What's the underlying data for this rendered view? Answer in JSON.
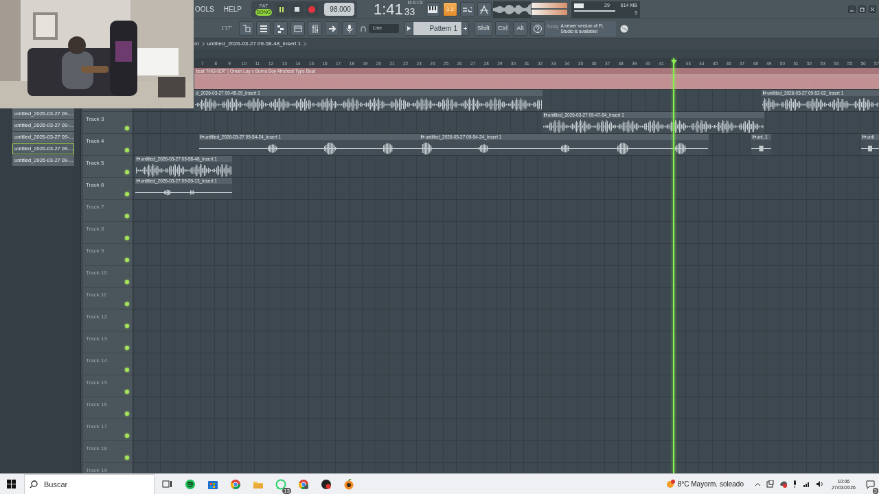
{
  "menu": [
    {
      "label": "OOLS"
    },
    {
      "label": "HELP"
    }
  ],
  "transport": {
    "modes": [
      {
        "label": "PAT",
        "selected": false
      },
      {
        "label": "SONG",
        "selected": true
      }
    ],
    "playing": true,
    "tempo": "98.000"
  },
  "time_display": {
    "value": "1:41",
    "fraction": "33",
    "unit": "M:S:CS"
  },
  "count_in": "3.2",
  "monitor": {
    "cpu": "29",
    "memory": "614 MB",
    "polyphony": "3"
  },
  "toolbar": {
    "position": "1'17\"",
    "snap": "Line",
    "pattern": "Pattern 1",
    "modifier_keys": [
      "Shift",
      "Ctrl",
      "Alt"
    ]
  },
  "news": {
    "date": "Today",
    "text": "A newer version of FL Studio is available!"
  },
  "breadcrumb": [
    "nt",
    "untitled_2026-03-27 09-58-48_Insert 1"
  ],
  "browser": [
    {
      "label": "untitled_2026-03-27 09-...",
      "selected": false
    },
    {
      "label": "untitled_2026-03-27 09-...",
      "selected": false
    },
    {
      "label": "untitled_2026-03-27 09-...",
      "selected": false
    },
    {
      "label": "untitled_2026-03-27 09-...",
      "selected": true
    },
    {
      "label": "untitled_2026-03-27 09-...",
      "selected": false
    }
  ],
  "ruler": [
    "7",
    "8",
    "9",
    "10",
    "11",
    "12",
    "13",
    "14",
    "15",
    "16",
    "17",
    "18",
    "19",
    "20",
    "21",
    "22",
    "23",
    "24",
    "25",
    "26",
    "27",
    "28",
    "29",
    "30",
    "31",
    "32",
    "33",
    "34",
    "35",
    "36",
    "37",
    "38",
    "39",
    "40",
    "41"
  ],
  "ruler_after_playhead": [
    "43",
    "44",
    "45",
    "46",
    "47",
    "48",
    "49",
    "50",
    "51",
    "52",
    "53",
    "54",
    "55",
    "56",
    "57"
  ],
  "tracks": [
    {
      "clips": [
        {
          "label": "beat \"HIGHER\" | Omah Lay x Burna Boy Afrobeat Type Beat",
          "kind": "full",
          "marker": false,
          "color": "#a8777b"
        }
      ]
    },
    {
      "clips": [
        {
          "label": "d_2026-03-27 09-45-29_Insert 1",
          "kind": "dense",
          "marker": false,
          "color": "#56616a"
        },
        {
          "label": "untitled_2026-03-27 09-52-02_Insert 1",
          "kind": "dense",
          "marker": true,
          "color": "#56616a"
        }
      ]
    },
    {
      "name": "Track 3",
      "enabled": true,
      "clips": [
        {
          "label": "untitled_2026-03-27 09-47-54_Insert 1",
          "kind": "dense",
          "marker": true,
          "color": "#56616a"
        }
      ]
    },
    {
      "name": "Track 4",
      "enabled": true,
      "clips": [
        {
          "label": "untitled_2026-03-27 09-54-24_Insert 1",
          "kind": "sparse",
          "marker": true,
          "color": "#56616a"
        },
        {
          "label": "untitled_2026-03-27 09-54-24_Insert 1",
          "kind": "sparse",
          "marker": true,
          "color": "#56616a"
        },
        {
          "label": "unt..1",
          "kind": "sparse",
          "marker": true,
          "color": "#56616a"
        },
        {
          "label": "unti",
          "kind": "sparse",
          "marker": true,
          "color": "#56616a"
        }
      ]
    },
    {
      "name": "Track 5",
      "enabled": true,
      "clips": [
        {
          "label": "untitled_2026-03-27 09-58-48_Insert 1",
          "kind": "dense",
          "marker": true,
          "color": "#56616a"
        }
      ]
    },
    {
      "name": "Track 6",
      "enabled": true,
      "clips": [
        {
          "label": "untitled_2026-03-27 09-59-13_Insert 1",
          "kind": "sparse",
          "marker": true,
          "color": "#56616a"
        }
      ]
    },
    {
      "name": "Track 7",
      "enabled": true
    },
    {
      "name": "Track 8",
      "enabled": true
    },
    {
      "name": "Track 9",
      "enabled": true
    },
    {
      "name": "Track 10",
      "enabled": true
    },
    {
      "name": "Track 11",
      "enabled": true
    },
    {
      "name": "Track 12",
      "enabled": true
    },
    {
      "name": "Track 13",
      "enabled": true
    },
    {
      "name": "Track 14",
      "enabled": true
    },
    {
      "name": "Track 15",
      "enabled": true
    },
    {
      "name": "Track 16",
      "enabled": true
    },
    {
      "name": "Track 17",
      "enabled": true
    },
    {
      "name": "Track 18",
      "enabled": true
    },
    {
      "name": "Track 19"
    }
  ],
  "taskbar": {
    "placeholder": "Buscar",
    "whatsapp_badge": "13",
    "weather": "8°C Mayorm. soleado",
    "time": "10:06",
    "date": "27/03/2026",
    "notifications": "3"
  }
}
